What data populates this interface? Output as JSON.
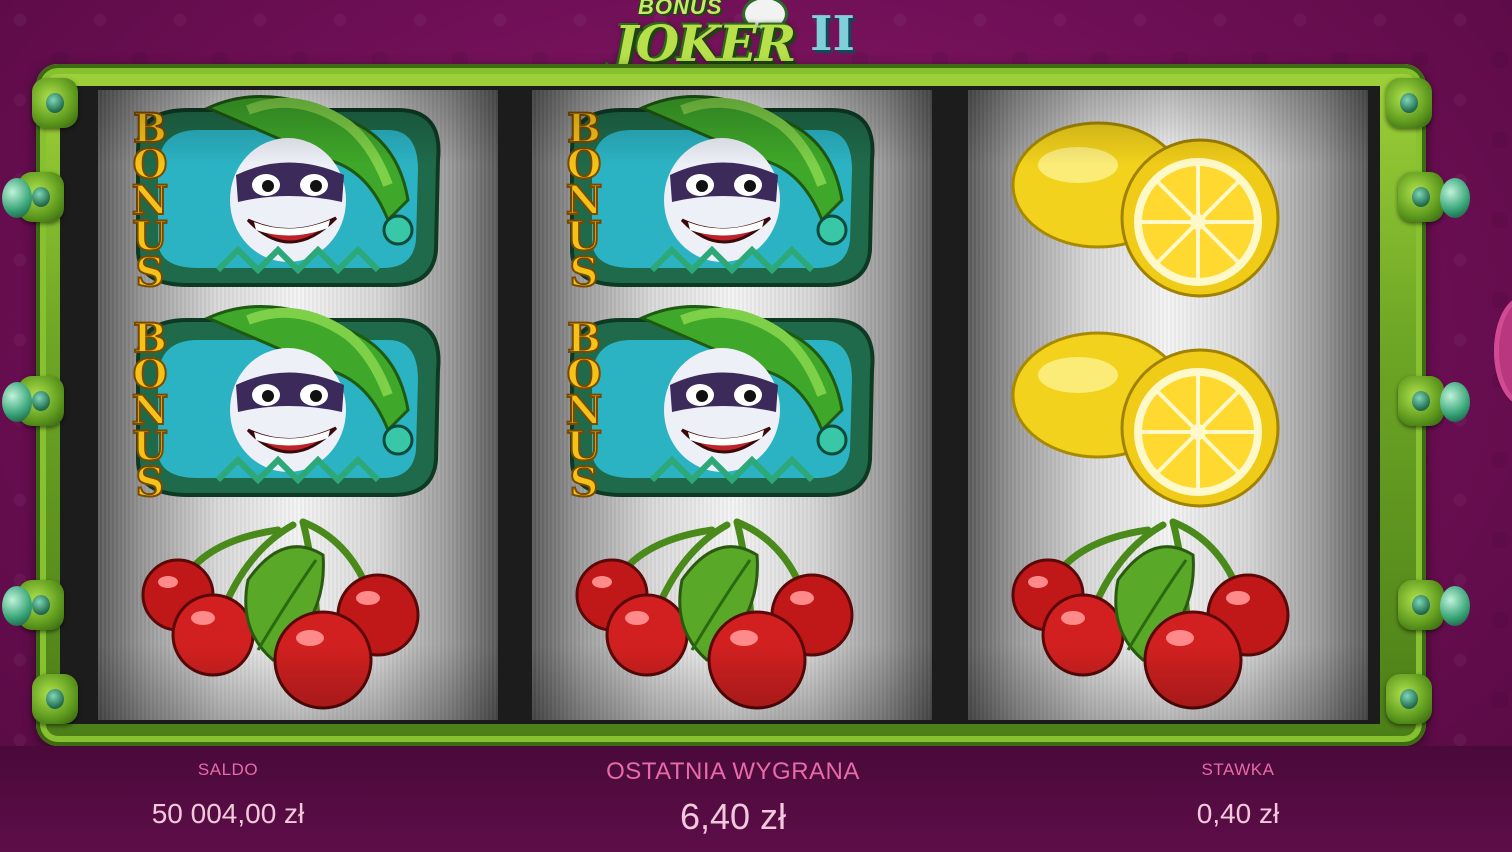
{
  "game": {
    "logo_bonus": "BONUS",
    "logo_joker": "JOKER",
    "logo_numeral": "II"
  },
  "reels": [
    {
      "symbols": [
        "bonus-joker",
        "bonus-joker",
        "cherry"
      ]
    },
    {
      "symbols": [
        "bonus-joker",
        "bonus-joker",
        "cherry"
      ]
    },
    {
      "symbols": [
        "lemon",
        "lemon",
        "cherry"
      ]
    }
  ],
  "symbol_text": {
    "bonus": "BONUS"
  },
  "info_bar": {
    "saldo_label": "SALDO",
    "saldo_value": "50 004,00 zł",
    "last_win_label": "OSTATNIA WYGRANA",
    "last_win_value": "6,40 zł",
    "bet_label": "STAWKA",
    "bet_value": "0,40 zł"
  },
  "colors": {
    "frame_green": "#86c230",
    "background": "#6e0f55",
    "label_pink": "#e86aa8",
    "value_pink": "#f2c9dc"
  }
}
